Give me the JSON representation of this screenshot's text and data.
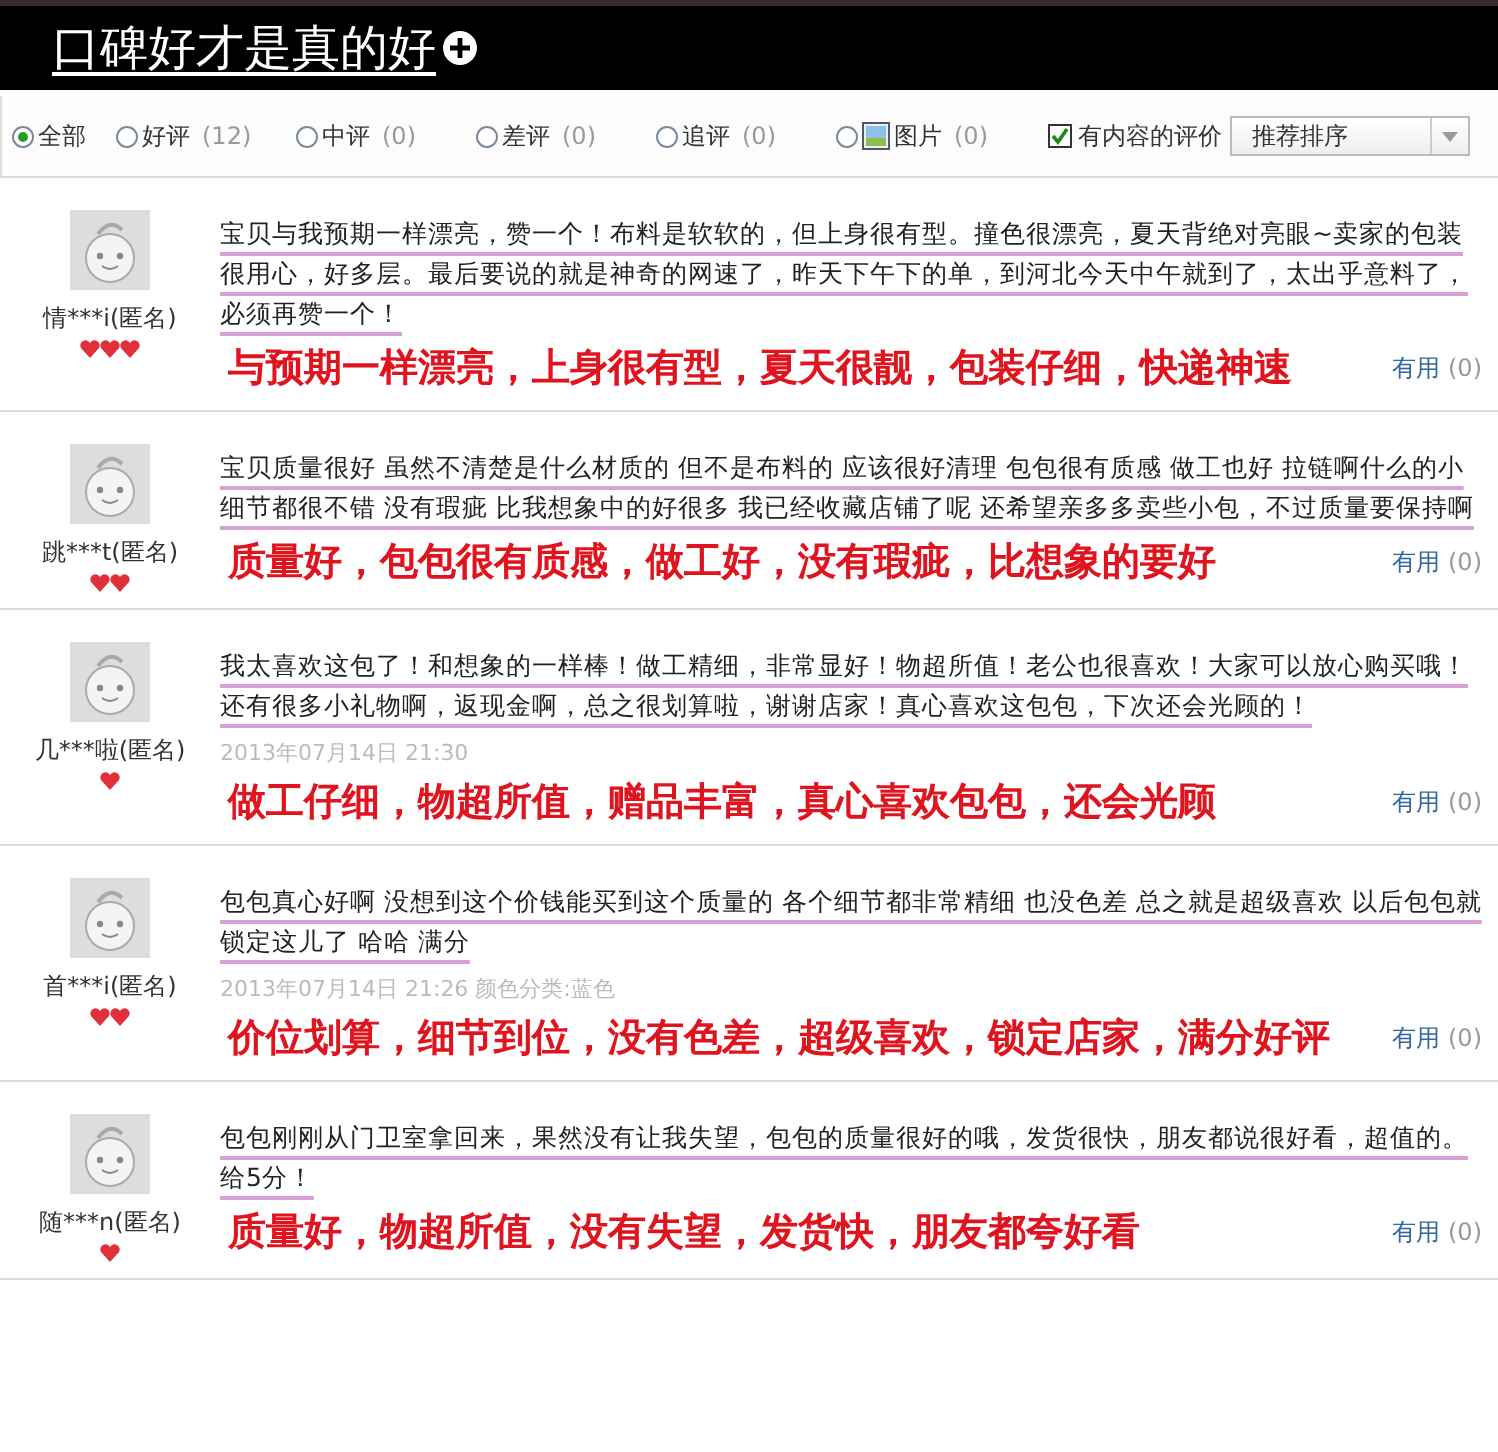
{
  "header": {
    "title": "口碑好才是真的好"
  },
  "filters": [
    {
      "label": "全部",
      "selected": true,
      "kind": "plain"
    },
    {
      "label": "好评",
      "count": "(12)",
      "selected": false,
      "kind": "plain"
    },
    {
      "label": "中评",
      "count": "(0)",
      "selected": false,
      "kind": "plain"
    },
    {
      "label": "差评",
      "count": "(0)",
      "selected": false,
      "kind": "plain"
    },
    {
      "label": "追评",
      "count": "(0)",
      "selected": false,
      "kind": "plain"
    },
    {
      "label": "图片",
      "count": "(0)",
      "selected": false,
      "kind": "image"
    }
  ],
  "content_filter": {
    "label": "有内容的评价",
    "checked": true
  },
  "sort": {
    "value": "推荐排序"
  },
  "reviews": [
    {
      "user": "情***i(匿名)",
      "badges": [
        {
          "kind": "heart"
        },
        {
          "kind": "heart"
        },
        {
          "kind": "heart"
        }
      ],
      "text": "宝贝与我预期一样漂亮，赞一个！布料是软软的，但上身很有型。撞色很漂亮，夏天背绝对亮眼~卖家的包装很用心，好多层。最后要说的就是神奇的网速了，昨天下午下的单，到河北今天中午就到了，太出乎意料了，必须再赞一个！",
      "annotation": "与预期一样漂亮，上身很有型，夏天很靓，包装仔细，快递神速",
      "useful": "有用",
      "useful_count": "(0)"
    },
    {
      "user": "跳***t(匿名)",
      "badges": [
        {
          "kind": "heart"
        },
        {
          "kind": "heart"
        }
      ],
      "text": "宝贝质量很好 虽然不清楚是什么材质的 但不是布料的 应该很好清理 包包很有质感 做工也好 拉链啊什么的小细节都很不错 没有瑕疵 比我想象中的好很多 我已经收藏店铺了呢 还希望亲多多卖些小包，不过质量要保持啊",
      "annotation": "质量好，包包很有质感，做工好，没有瑕疵，比想象的要好",
      "useful": "有用",
      "useful_count": "(0)"
    },
    {
      "user": "几***啦(匿名)",
      "badges": [
        {
          "kind": "heart"
        }
      ],
      "text": "我太喜欢这包了！和想象的一样棒！做工精细，非常显好！物超所值！老公也很喜欢！大家可以放心购买哦！还有很多小礼物啊，返现金啊，总之很划算啦，谢谢店家！真心喜欢这包包，下次还会光顾的！",
      "date": "2013年07月14日 21:30",
      "annotation": "做工仔细，物超所值，赠品丰富，真心喜欢包包，还会光顾",
      "useful": "有用",
      "useful_count": "(0)"
    },
    {
      "user": "首***i(匿名)",
      "badges": [
        {
          "kind": "heart"
        },
        {
          "kind": "heart"
        }
      ],
      "text": "包包真心好啊 没想到这个价钱能买到这个质量的 各个细节都非常精细 也没色差 总之就是超级喜欢 以后包包就锁定这儿了 哈哈 满分",
      "date": "2013年07月14日 21:26  颜色分类:蓝色",
      "annotation": "价位划算，细节到位，没有色差，超级喜欢，锁定店家，满分好评",
      "useful": "有用",
      "useful_count": "(0)"
    },
    {
      "user": "随***n(匿名)",
      "badges": [
        {
          "kind": "heart"
        }
      ],
      "text": "包包刚刚从门卫室拿回来，果然没有让我失望，包包的质量很好的哦，发货很快，朋友都说很好看，超值的。给5分！",
      "annotation": "质量好，物超所值，没有失望，发货快，朋友都夸好看",
      "useful": "有用",
      "useful_count": "(0)"
    }
  ]
}
